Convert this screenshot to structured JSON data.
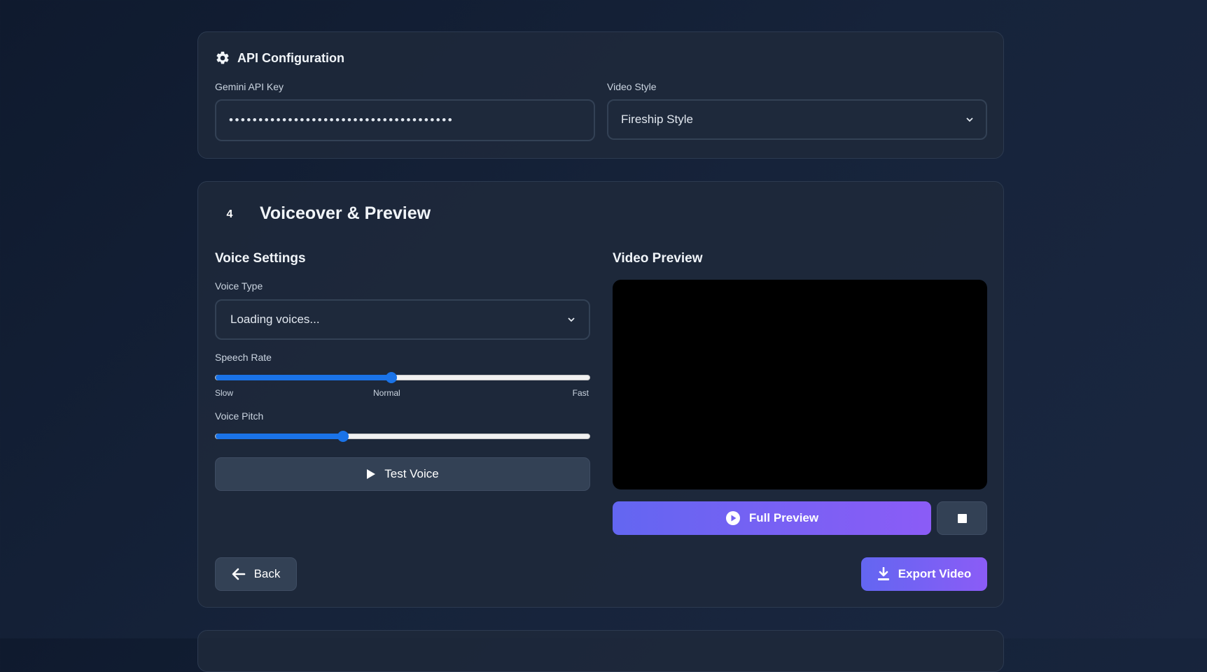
{
  "colors": {
    "accent_start": "#6366f1",
    "accent_end": "#8b5cf6",
    "slider": "#1a73e8",
    "card": "#1e293b",
    "background": "#0f1a2e"
  },
  "api_config": {
    "title": "API Configuration",
    "icon": "gear-icon",
    "api_key_label": "Gemini API Key",
    "api_key_value": "••••••••••••••••••••••••••••••••••••••",
    "video_style_label": "Video Style",
    "video_style_selected": "Fireship Style"
  },
  "voiceover": {
    "step_number": "4",
    "title": "Voiceover & Preview",
    "voice_settings": {
      "title": "Voice Settings",
      "voice_type_label": "Voice Type",
      "voice_type_selected": "Loading voices...",
      "speech_rate_label": "Speech Rate",
      "speech_rate_value": 0.47,
      "speech_rate_ticks": [
        "Slow",
        "Normal",
        "Fast"
      ],
      "voice_pitch_label": "Voice Pitch",
      "voice_pitch_value": 0.34,
      "test_voice_label": "Test Voice"
    },
    "video_preview": {
      "title": "Video Preview",
      "full_preview_label": "Full Preview"
    },
    "back_label": "Back",
    "export_label": "Export Video"
  }
}
